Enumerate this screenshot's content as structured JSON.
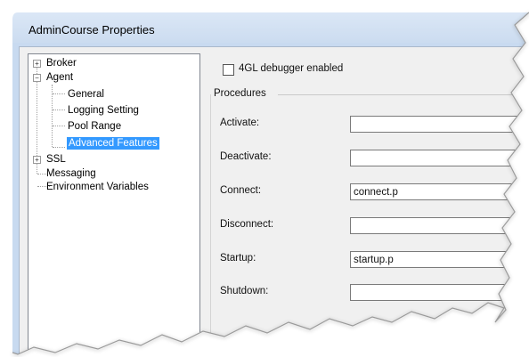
{
  "window": {
    "title": "AdminCourse Properties"
  },
  "tree": {
    "broker": "Broker",
    "agent": "Agent",
    "agent_children": [
      "General",
      "Logging Setting",
      "Pool Range",
      "Advanced Features"
    ],
    "ssl": "SSL",
    "messaging": "Messaging",
    "env": "Environment Variables"
  },
  "options": {
    "debugger_label": "4GL debugger enabled",
    "debugger_checked": false
  },
  "procedures": {
    "group_title": "Procedures",
    "fields": [
      {
        "label": "Activate:",
        "value": ""
      },
      {
        "label": "Deactivate:",
        "value": ""
      },
      {
        "label": "Connect:",
        "value": "connect.p"
      },
      {
        "label": "Disconnect:",
        "value": ""
      },
      {
        "label": "Startup:",
        "value": "startup.p"
      },
      {
        "label": "Shutdown:",
        "value": ""
      }
    ]
  },
  "colors": {
    "selection": "#3399ff",
    "title_bar": "#c6d8ee"
  }
}
